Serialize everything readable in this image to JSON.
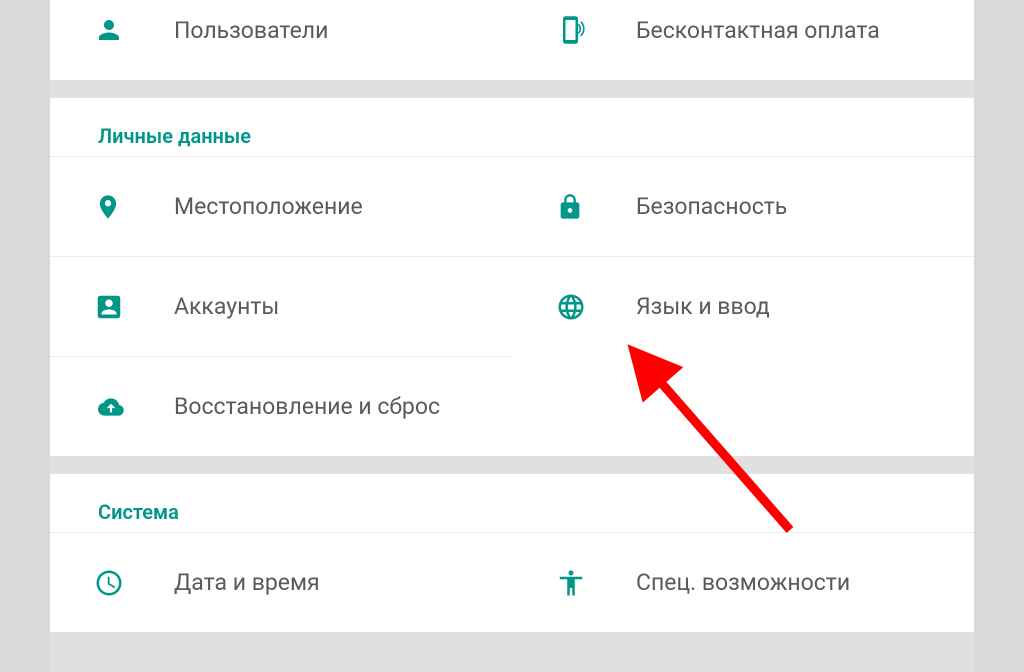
{
  "colors": {
    "accent": "#009688",
    "arrow": "#ff0000"
  },
  "top_section": {
    "left": {
      "label": "Пользователи"
    },
    "right": {
      "label": "Бесконтактная оплата"
    }
  },
  "personal": {
    "header": "Личные данные",
    "items": [
      {
        "label": "Местоположение"
      },
      {
        "label": "Безопасность"
      },
      {
        "label": "Аккаунты"
      },
      {
        "label": "Язык и ввод"
      },
      {
        "label": "Восстановление и сброс"
      }
    ]
  },
  "system": {
    "header": "Система",
    "items": [
      {
        "label": "Дата и время"
      },
      {
        "label": "Спец. возможности"
      }
    ]
  }
}
